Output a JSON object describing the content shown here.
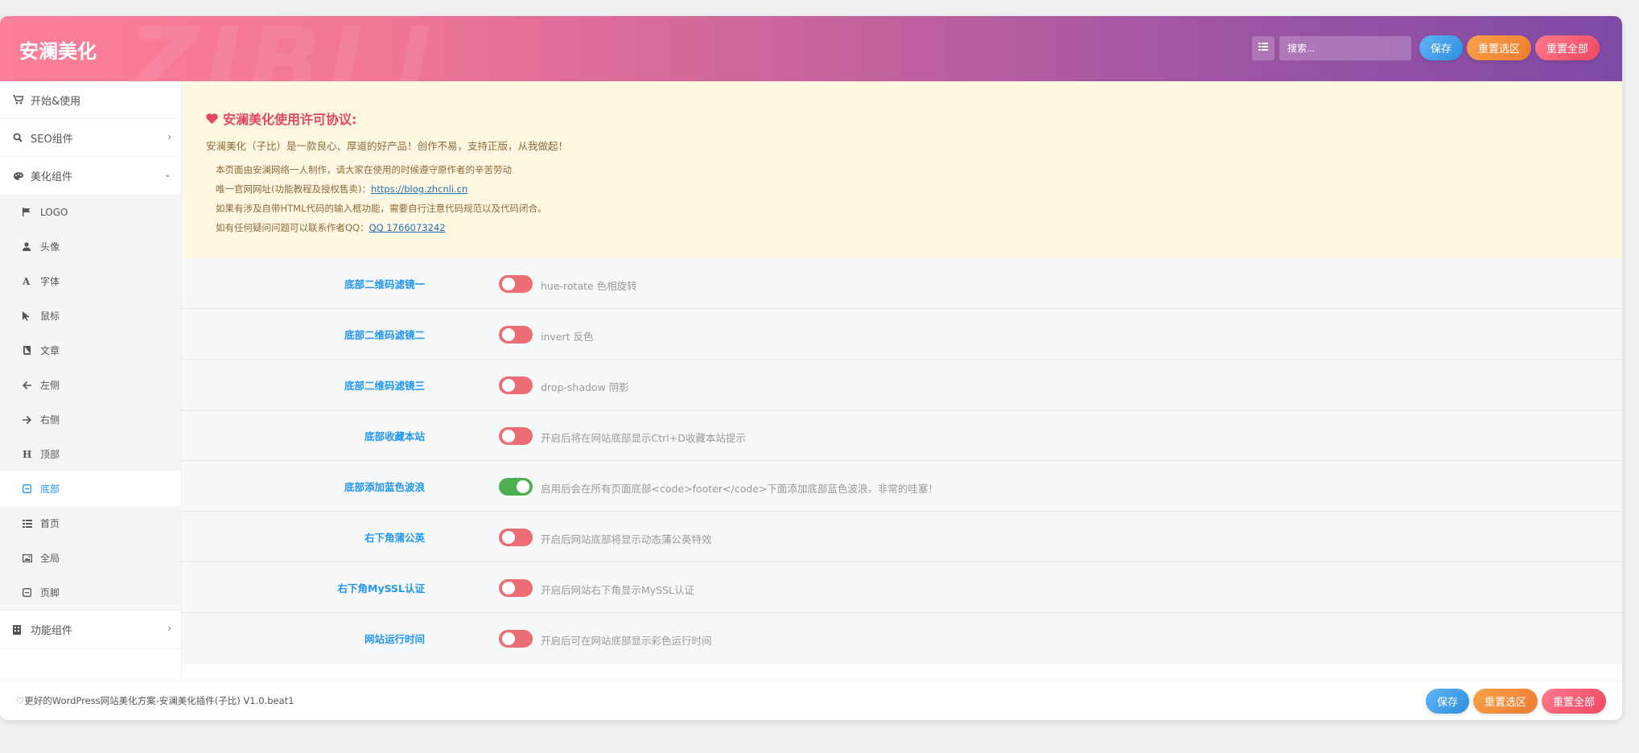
{
  "header": {
    "title": "安澜美化",
    "watermark": "ZIBLL",
    "search_placeholder": "搜索...",
    "save_label": "保存",
    "reset_section_label": "重置选区",
    "reset_all_label": "重置全部"
  },
  "sidebar": {
    "items": [
      {
        "label": "开始&使用",
        "icon": "cart-icon"
      },
      {
        "label": "SEO组件",
        "icon": "search-icon"
      },
      {
        "label": "美化组件",
        "icon": "palette-icon"
      }
    ],
    "sub_items": [
      {
        "label": "LOGO",
        "icon": "flag-icon"
      },
      {
        "label": "头像",
        "icon": "user-icon"
      },
      {
        "label": "字体",
        "icon": "font-icon"
      },
      {
        "label": "鼠标",
        "icon": "cursor-icon"
      },
      {
        "label": "文章",
        "icon": "book-icon"
      },
      {
        "label": "左侧",
        "icon": "arrow-left-icon"
      },
      {
        "label": "右侧",
        "icon": "arrow-right-icon"
      },
      {
        "label": "顶部",
        "icon": "heading-icon"
      },
      {
        "label": "底部",
        "icon": "footer-icon"
      },
      {
        "label": "首页",
        "icon": "list-icon"
      },
      {
        "label": "全局",
        "icon": "image-icon"
      },
      {
        "label": "页脚",
        "icon": "footer-box-icon"
      }
    ],
    "bottom_item": {
      "label": "功能组件",
      "icon": "building-icon"
    }
  },
  "notice": {
    "title": "安澜美化使用许可协议:",
    "lead": "安澜美化（子比）是一款良心、厚道的好产品！创作不易，支持正版，从我做起！",
    "line1": "本页面由安澜网络一人制作，请大家在使用的时候遵守原作者的辛苦劳动",
    "line2_prefix": "唯一官网网址(功能教程及授权售卖)：",
    "line2_link": "https://blog.zhcnli.cn",
    "line3": "如果有涉及自带HTML代码的输入框功能，需要自行注意代码规范以及代码闭合。",
    "line4_prefix": "如有任何疑问问题可以联系作者QQ：",
    "line4_link": "QQ 1766073242"
  },
  "settings": [
    {
      "label": "底部二维码滤镜一",
      "on": false,
      "desc": "hue-rotate 色相旋转"
    },
    {
      "label": "底部二维码滤镜二",
      "on": false,
      "desc": "invert 反色"
    },
    {
      "label": "底部二维码滤镜三",
      "on": false,
      "desc": "drop-shadow 阴影"
    },
    {
      "label": "底部收藏本站",
      "on": false,
      "desc": "开启后将在网站底部显示Ctrl+D收藏本站提示"
    },
    {
      "label": "底部添加蓝色波浪",
      "on": true,
      "desc": "启用后会在所有页面底部<code>footer</code>下面添加底部蓝色波浪，非常的哇塞！"
    },
    {
      "label": "右下角蒲公英",
      "on": false,
      "desc": "开启后网站底部将显示动态蒲公英特效"
    },
    {
      "label": "右下角MySSL认证",
      "on": false,
      "desc": "开启后网站右下角显示MySSL认证"
    },
    {
      "label": "网站运行时间",
      "on": false,
      "desc": "开启后可在网站底部显示彩色运行时间"
    }
  ],
  "footer": {
    "text": "♡更好的WordPress网站美化方案-安澜美化插件(子比) V1.0.beat1",
    "save_label": "保存",
    "reset_section_label": "重置选区",
    "reset_all_label": "重置全部"
  },
  "colors": {
    "header_start": "#fd7f98",
    "header_end": "#7e4aa6",
    "label_blue": "#2196f3",
    "toggle_off": "#ee6c73",
    "toggle_on": "#4caf50",
    "notice_bg": "#fff7e2",
    "notice_title": "#e4475e"
  }
}
